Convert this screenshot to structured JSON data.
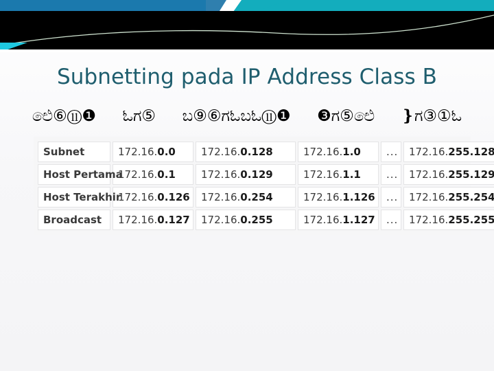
{
  "slide": {
    "title": "Subnetting pada IP Address Class B",
    "title_color": "#1f5e6e",
    "background_color": "#fafafb"
  },
  "header": {
    "bar_blue": "#1b79ad",
    "bar_teal": "#13adbd",
    "band_black": "#000000",
    "accent_cyan": "#1ec8e0",
    "wave_line": "#cfe3d0"
  },
  "glyph_row": {
    "segments": [
      "ඓ⑥⑪❶",
      "ಓಗ⑤",
      "ಬ⑨⑥ಗಓಬಓ⑪❶",
      "❸ಗ⑤ඓ",
      "❵ಗ③①ಓ"
    ]
  },
  "table": {
    "rows": [
      {
        "label": "Subnet",
        "cells": [
          {
            "prefix": "172.16.",
            "suffix": "0.0"
          },
          {
            "prefix": "172.16.",
            "suffix": "0.128"
          },
          {
            "prefix": "172.16.",
            "suffix": "1.0"
          }
        ],
        "ellipsis": "...",
        "last": {
          "prefix": "172.16.",
          "suffix": "255.128"
        }
      },
      {
        "label": "Host Pertama",
        "cells": [
          {
            "prefix": "172.16.",
            "suffix": "0.1"
          },
          {
            "prefix": "172.16.",
            "suffix": "0.129"
          },
          {
            "prefix": "172.16.",
            "suffix": "1.1"
          }
        ],
        "ellipsis": "...",
        "last": {
          "prefix": "172.16.",
          "suffix": "255.129"
        }
      },
      {
        "label": "Host Terakhir",
        "cells": [
          {
            "prefix": "172.16.",
            "suffix": "0.126"
          },
          {
            "prefix": "172.16.",
            "suffix": "0.254"
          },
          {
            "prefix": "172.16.",
            "suffix": "1.126"
          }
        ],
        "ellipsis": "...",
        "last": {
          "prefix": "172.16.",
          "suffix": "255.254"
        }
      },
      {
        "label": "Broadcast",
        "cells": [
          {
            "prefix": "172.16.",
            "suffix": "0.127"
          },
          {
            "prefix": "172.16.",
            "suffix": "0.255"
          },
          {
            "prefix": "172.16.",
            "suffix": "1.127"
          }
        ],
        "ellipsis": "...",
        "last": {
          "prefix": "172.16.",
          "suffix": "255.255"
        }
      }
    ]
  }
}
